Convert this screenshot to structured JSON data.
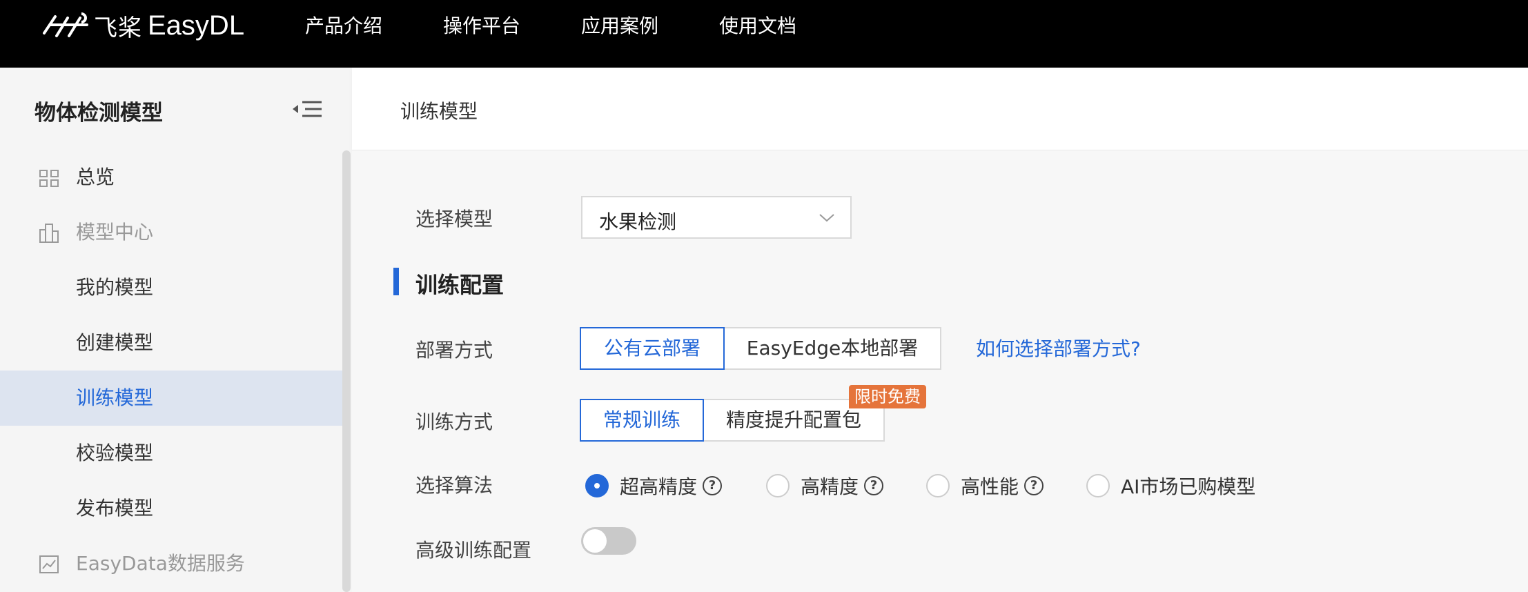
{
  "topbar": {
    "logo_cn": "飞桨",
    "logo_en": "EasyDL",
    "nav": [
      "产品介绍",
      "操作平台",
      "应用案例",
      "使用文档"
    ]
  },
  "sidebar": {
    "title": "物体检测模型",
    "items": [
      {
        "label": "总览",
        "icon": "grid-icon"
      },
      {
        "label": "模型中心",
        "icon": "building-icon"
      },
      {
        "label": "我的模型"
      },
      {
        "label": "创建模型"
      },
      {
        "label": "训练模型"
      },
      {
        "label": "校验模型"
      },
      {
        "label": "发布模型"
      },
      {
        "label": "EasyData数据服务",
        "icon": "chart-icon"
      }
    ],
    "active": "训练模型"
  },
  "main": {
    "breadcrumb": "训练模型",
    "select_model": {
      "label": "选择模型",
      "value": "水果检测"
    },
    "section_title": "训练配置",
    "deploy": {
      "label": "部署方式",
      "options": [
        "公有云部署",
        "EasyEdge本地部署"
      ],
      "selected": "公有云部署",
      "help_link": "如何选择部署方式?"
    },
    "train_mode": {
      "label": "训练方式",
      "options": [
        "常规训练",
        "精度提升配置包"
      ],
      "selected": "常规训练",
      "badge": "限时免费"
    },
    "algorithm": {
      "label": "选择算法",
      "options": [
        "超高精度",
        "高精度",
        "高性能",
        "AI市场已购模型"
      ],
      "selected": "超高精度",
      "help_glyph": "?"
    },
    "advanced": {
      "label": "高级训练配置",
      "enabled": false
    }
  },
  "colors": {
    "accent": "#2468d8",
    "badge": "#e5743b",
    "topbar": "#000000"
  }
}
